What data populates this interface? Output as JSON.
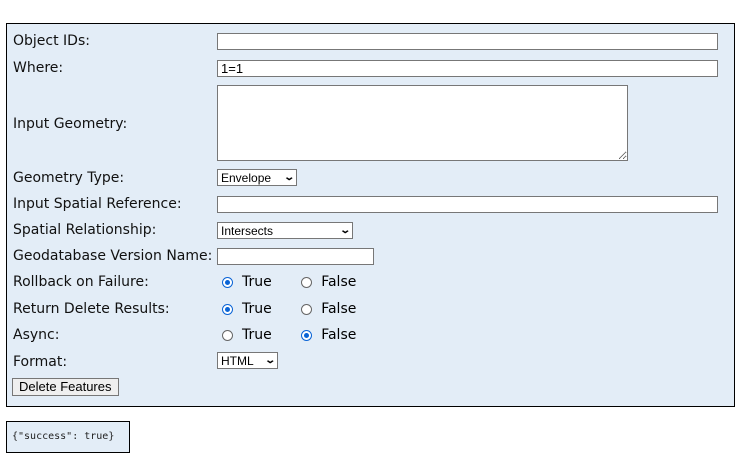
{
  "form": {
    "object_ids": {
      "label": "Object IDs:",
      "value": ""
    },
    "where": {
      "label": "Where:",
      "value": "1=1"
    },
    "input_geometry": {
      "label": "Input Geometry:",
      "value": ""
    },
    "geometry_type": {
      "label": "Geometry Type:",
      "value": "Envelope"
    },
    "input_sr": {
      "label": "Input Spatial Reference:",
      "value": ""
    },
    "spatial_rel": {
      "label": "Spatial Relationship:",
      "value": "Intersects"
    },
    "gdb_version": {
      "label": "Geodatabase Version Name:",
      "value": ""
    },
    "rollback": {
      "label": "Rollback on Failure:",
      "true_label": "True",
      "false_label": "False",
      "selected": "True"
    },
    "return_delete": {
      "label": "Return Delete Results:",
      "true_label": "True",
      "false_label": "False",
      "selected": "True"
    },
    "async": {
      "label": "Async:",
      "true_label": "True",
      "false_label": "False",
      "selected": "False"
    },
    "format": {
      "label": "Format:",
      "value": "HTML"
    },
    "submit_label": "Delete Features"
  },
  "result": {
    "text": "{\"success\": true}"
  },
  "colors": {
    "panel": "#e3edf7",
    "radio_accent": "#0a64d6"
  }
}
